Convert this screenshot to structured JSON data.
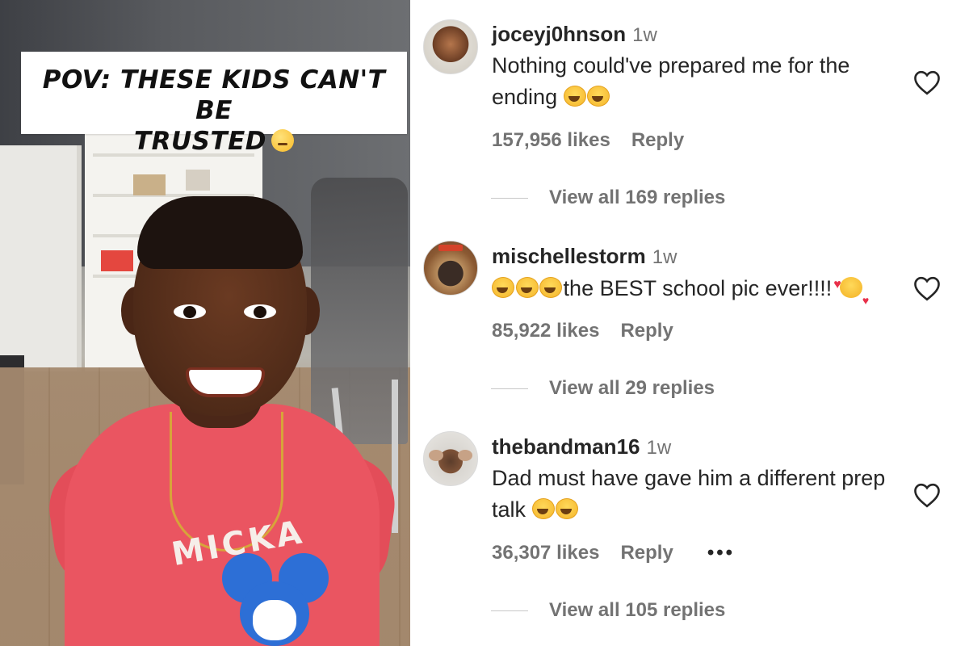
{
  "photo": {
    "caption_line1": "POV: THESE KIDS CAN'T BE",
    "caption_line2": "TRUSTED",
    "caption_emoji": "unamused-face-emoji",
    "shirt_print": "MICKA"
  },
  "comments": [
    {
      "username": "joceyj0hnson",
      "time": "1w",
      "text": "Nothing could've prepared me for the ending",
      "emoji": "laughing-tears-emoji x2",
      "likes": "157,956 likes",
      "reply": "Reply",
      "view_replies": "View all 169 replies"
    },
    {
      "username": "mischellestorm",
      "time": "1w",
      "text": "the BEST school pic ever!!!!",
      "emoji": "laughing-tears-emoji x3, smiling-face-with-hearts-emoji",
      "likes": "85,922 likes",
      "reply": "Reply",
      "view_replies": "View all 29 replies"
    },
    {
      "username": "thebandman16",
      "time": "1w",
      "text": "Dad must have gave him a different prep talk",
      "emoji": "laughing-tears-emoji x2",
      "likes": "36,307 likes",
      "reply": "Reply",
      "more": "•••",
      "view_replies": "View all 105 replies"
    }
  ],
  "colors": {
    "text_primary": "#262626",
    "text_secondary": "#737373",
    "shirt": "#ea5561",
    "mickey_blue": "#2d6fd6"
  }
}
